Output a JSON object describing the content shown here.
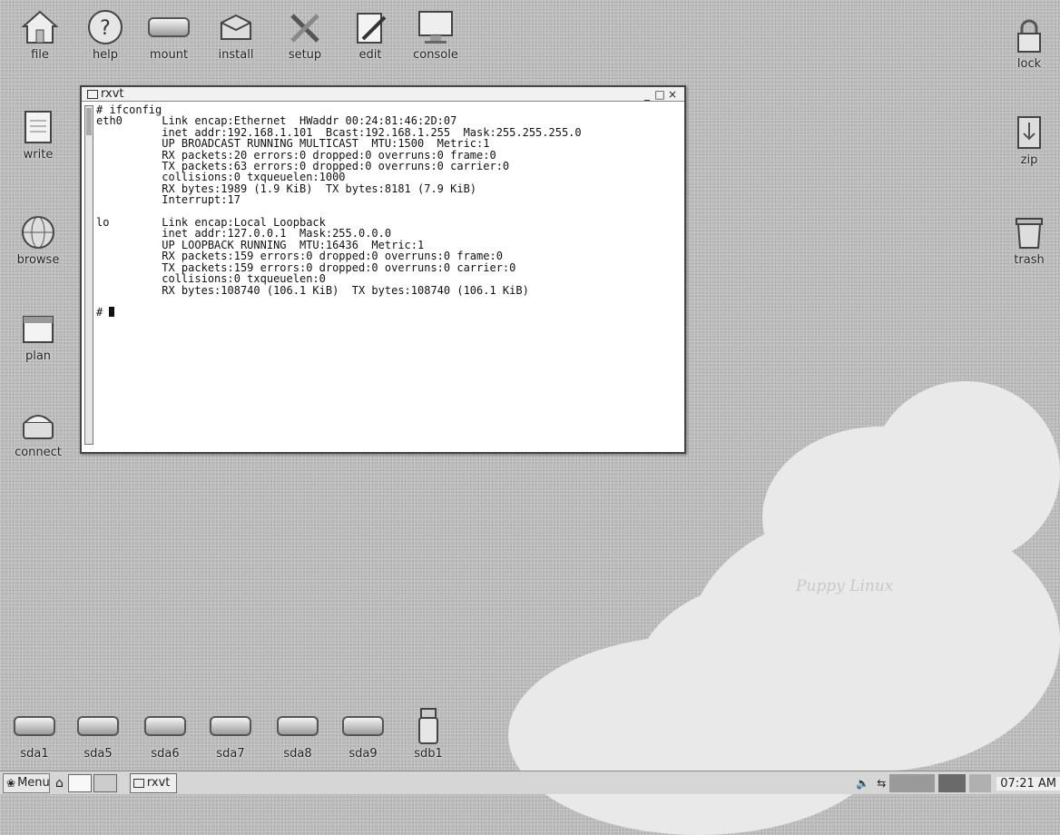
{
  "desktop": {
    "top_icons": [
      {
        "label": "file",
        "icon": "house-icon"
      },
      {
        "label": "help",
        "icon": "help-icon"
      },
      {
        "label": "mount",
        "icon": "drive-icon"
      },
      {
        "label": "install",
        "icon": "package-icon"
      },
      {
        "label": "setup",
        "icon": "tools-icon"
      },
      {
        "label": "edit",
        "icon": "edit-icon"
      },
      {
        "label": "console",
        "icon": "monitor-icon"
      }
    ],
    "left_icons": [
      {
        "label": "write",
        "icon": "document-icon"
      },
      {
        "label": "browse",
        "icon": "globe-icon"
      },
      {
        "label": "plan",
        "icon": "calendar-icon"
      },
      {
        "label": "connect",
        "icon": "phone-icon"
      }
    ],
    "right_icons": [
      {
        "label": "lock",
        "icon": "lock-icon"
      },
      {
        "label": "zip",
        "icon": "zip-icon"
      },
      {
        "label": "trash",
        "icon": "trash-icon"
      }
    ],
    "drives": [
      {
        "label": "sda1"
      },
      {
        "label": "sda5"
      },
      {
        "label": "sda6"
      },
      {
        "label": "sda7"
      },
      {
        "label": "sda8"
      },
      {
        "label": "sda9"
      },
      {
        "label": "sdb1"
      }
    ],
    "wallpaper_text": "Puppy Linux"
  },
  "window": {
    "title": "rxvt",
    "terminal_lines": [
      "# ifconfig",
      "eth0      Link encap:Ethernet  HWaddr 00:24:81:46:2D:07",
      "          inet addr:192.168.1.101  Bcast:192.168.1.255  Mask:255.255.255.0",
      "          UP BROADCAST RUNNING MULTICAST  MTU:1500  Metric:1",
      "          RX packets:20 errors:0 dropped:0 overruns:0 frame:0",
      "          TX packets:63 errors:0 dropped:0 overruns:0 carrier:0",
      "          collisions:0 txqueuelen:1000",
      "          RX bytes:1989 (1.9 KiB)  TX bytes:8181 (7.9 KiB)",
      "          Interrupt:17",
      "",
      "lo        Link encap:Local Loopback",
      "          inet addr:127.0.0.1  Mask:255.0.0.0",
      "          UP LOOPBACK RUNNING  MTU:16436  Metric:1",
      "          RX packets:159 errors:0 dropped:0 overruns:0 frame:0",
      "          TX packets:159 errors:0 dropped:0 overruns:0 carrier:0",
      "          collisions:0 txqueuelen:0",
      "          RX bytes:108740 (106.1 KiB)  TX bytes:108740 (106.1 KiB)",
      ""
    ],
    "prompt": "# "
  },
  "taskbar": {
    "menu_label": "Menu",
    "task_label": "rxvt",
    "clock": "07:21 AM"
  }
}
